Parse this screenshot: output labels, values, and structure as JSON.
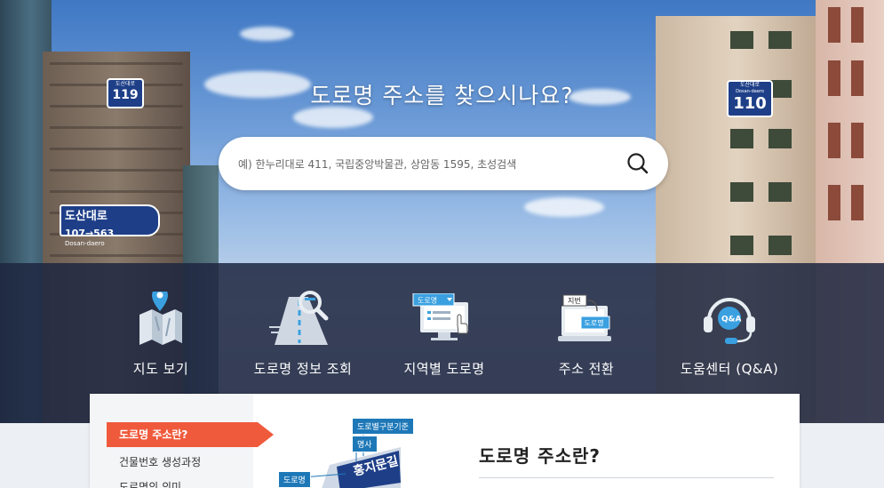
{
  "hero": {
    "title": "도로명 주소를 찾으시나요?",
    "search": {
      "placeholder": "예) 한누리대로 411, 국립중앙박물관, 상암동 1595, 초성검색",
      "value": ""
    }
  },
  "signs": {
    "left_top": {
      "name": "도산대로",
      "number": "119"
    },
    "left_street": {
      "name": "도산대로",
      "range": "107→563",
      "romanized": "Dosan-daero"
    },
    "right_top": {
      "name": "도산대로",
      "romanized": "Dosan-daero",
      "number": "110"
    }
  },
  "nav": [
    {
      "label": "지도 보기",
      "icon": "map-pin-icon"
    },
    {
      "label": "도로명 정보 조회",
      "icon": "road-search-icon"
    },
    {
      "label": "지역별 도로명",
      "icon": "region-monitor-icon",
      "badge": "도로명"
    },
    {
      "label": "주소 전환",
      "icon": "address-convert-icon",
      "badge_from": "지번",
      "badge_to": "도로명"
    },
    {
      "label": "도움센터 (Q&A)",
      "icon": "headset-icon",
      "badge": "Q&A"
    }
  ],
  "sidebar": {
    "items": [
      {
        "label": "도로명 주소란?",
        "active": true
      },
      {
        "label": "건물번호 생성과정",
        "active": false
      },
      {
        "label": "도로명의 의미",
        "active": false
      }
    ]
  },
  "illustration": {
    "tags": [
      "도로별구분기준",
      "명사",
      "도로명"
    ],
    "sign_text": "홍지문길"
  },
  "content": {
    "title": "도로명 주소란?"
  },
  "colors": {
    "accent": "#f05a3c",
    "nav_band": "#1e2640",
    "sign_blue": "#1e3f88"
  }
}
